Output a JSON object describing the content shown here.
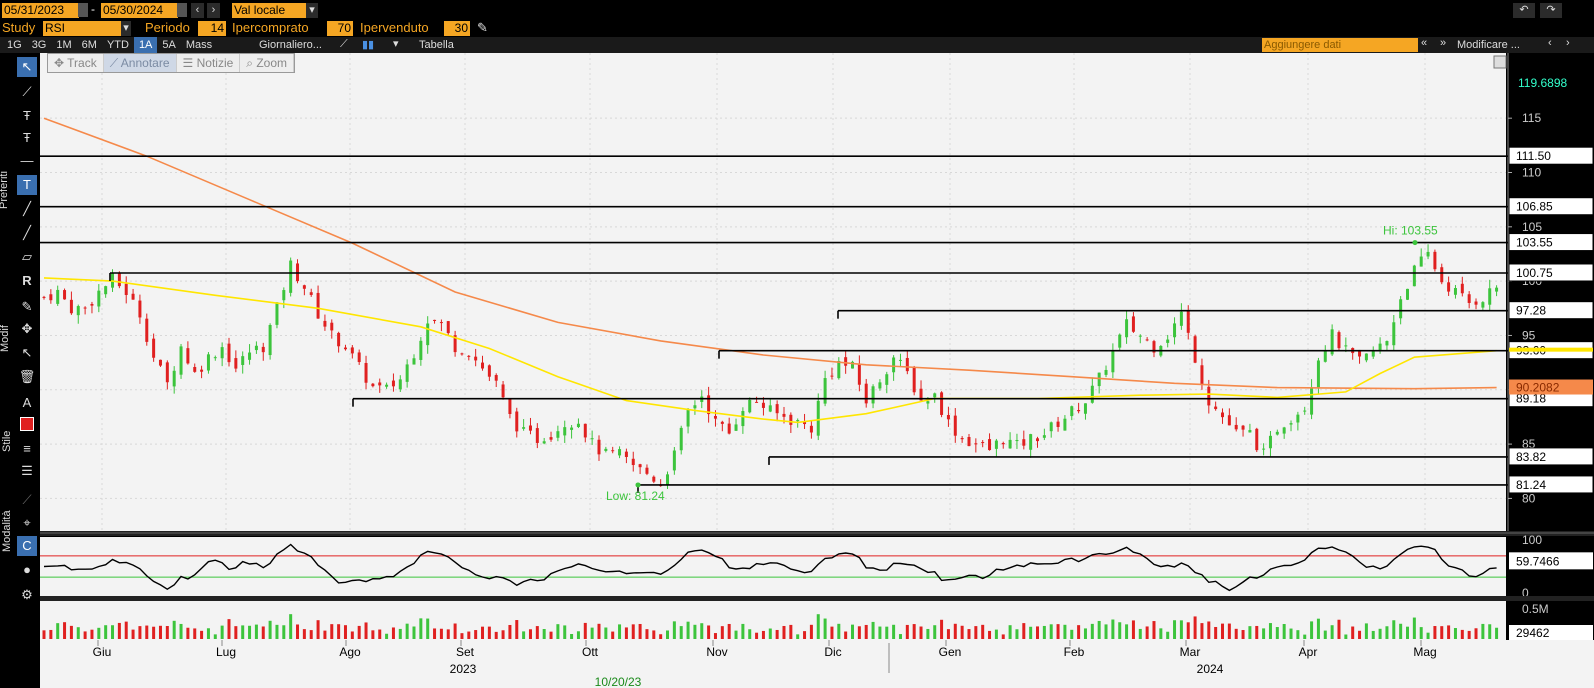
{
  "toolbar": {
    "date_start": "05/31/2023",
    "date_sep": "-",
    "date_end": "05/30/2024",
    "currency": "Val locale",
    "study_label": "Study",
    "study_value": "RSI",
    "period_label": "Periodo",
    "period_value": "14",
    "overbought_label": "Ipercomprato",
    "overbought_value": "70",
    "oversold_label": "Ipervenduto",
    "oversold_value": "30",
    "ranges": [
      "1G",
      "3G",
      "1M",
      "6M",
      "YTD",
      "1A",
      "5A",
      "Mass"
    ],
    "selected_range": "1A",
    "frequency": "Giornaliero...",
    "table_label": "Tabella",
    "add_data_placeholder": "Aggiungere dati",
    "modify_label": "Modificare ..."
  },
  "chart_tools": [
    "Track",
    "Annotare",
    "Notizie",
    "Zoom"
  ],
  "chart_tools_selected": "Annotare",
  "sidebar_labels": [
    "Preferiti",
    "Modif",
    "Stile",
    "Modalità"
  ],
  "colors": {
    "up": "#3cc43c",
    "down": "#e02020",
    "ma_short": "#ffe600",
    "ma_long": "#f5894a",
    "rsi_high": "#e02020",
    "rsi_low": "#3cc43c",
    "accent": "#f5a623"
  },
  "chart_data": [
    {
      "type": "candlestick",
      "ylim": [
        77,
        121
      ],
      "yticks": [
        80,
        85,
        90,
        95,
        100,
        105,
        110,
        115
      ],
      "last_price_label": "119.6898",
      "x_months": [
        "Giu",
        "Lug",
        "Ago",
        "Set",
        "Ott",
        "Nov",
        "Dic",
        "Gen",
        "Feb",
        "Mar",
        "Apr",
        "Mag"
      ],
      "x_years": [
        "2023",
        "2024"
      ],
      "crosshair_date": "10/20/23",
      "hi_annotation": "Hi: 103.55",
      "low_annotation": "Low: 81.24",
      "horizontal_lines": [
        {
          "value": 111.5,
          "label": "111.50"
        },
        {
          "value": 106.85,
          "label": "106.85"
        },
        {
          "value": 103.55,
          "label": "103.55"
        },
        {
          "value": 100.75,
          "label": "100.75"
        },
        {
          "value": 97.28,
          "label": "97.28"
        },
        {
          "value": 93.6,
          "label": "93.60"
        },
        {
          "value": 89.18,
          "label": "89.18"
        },
        {
          "value": 83.82,
          "label": "83.82"
        },
        {
          "value": 81.24,
          "label": "81.24"
        }
      ],
      "ma_short_label": "93.60",
      "ma_long_label": "90.2082",
      "close_points": [
        [
          0,
          98.5
        ],
        [
          4,
          99
        ],
        [
          8,
          97.5
        ],
        [
          12,
          97.5
        ],
        [
          16,
          99
        ],
        [
          20,
          100.2
        ],
        [
          24,
          99
        ],
        [
          28,
          97
        ],
        [
          32,
          93
        ],
        [
          36,
          90.5
        ],
        [
          40,
          94
        ],
        [
          44,
          91.5
        ],
        [
          48,
          93
        ],
        [
          52,
          94
        ],
        [
          56,
          92
        ],
        [
          60,
          93.5
        ],
        [
          64,
          94
        ],
        [
          68,
          97.5
        ],
        [
          72,
          101.5
        ],
        [
          76,
          99.5
        ],
        [
          80,
          97
        ],
        [
          84,
          95
        ],
        [
          88,
          94
        ],
        [
          92,
          92
        ],
        [
          96,
          90.2
        ],
        [
          100,
          90
        ],
        [
          104,
          91
        ],
        [
          108,
          93.5
        ],
        [
          112,
          96.5
        ],
        [
          116,
          96
        ],
        [
          120,
          94
        ],
        [
          124,
          93.5
        ],
        [
          128,
          92
        ],
        [
          132,
          90.5
        ],
        [
          136,
          87.5
        ],
        [
          140,
          86
        ],
        [
          144,
          85.5
        ],
        [
          148,
          86
        ],
        [
          152,
          87
        ],
        [
          156,
          87.2
        ],
        [
          160,
          85
        ],
        [
          164,
          84
        ],
        [
          168,
          84
        ],
        [
          172,
          83
        ],
        [
          176,
          82.3
        ],
        [
          180,
          81.4
        ],
        [
          184,
          84
        ],
        [
          188,
          88
        ],
        [
          192,
          89.5
        ],
        [
          196,
          87
        ],
        [
          200,
          86
        ],
        [
          204,
          88.5
        ],
        [
          208,
          89
        ],
        [
          212,
          88
        ],
        [
          216,
          87.5
        ],
        [
          220,
          87
        ],
        [
          224,
          86.5
        ],
        [
          228,
          91
        ],
        [
          232,
          92.5
        ],
        [
          236,
          92
        ],
        [
          240,
          89
        ],
        [
          244,
          91
        ],
        [
          248,
          93
        ],
        [
          252,
          91.5
        ],
        [
          256,
          89
        ],
        [
          260,
          89.5
        ],
        [
          264,
          87
        ],
        [
          268,
          85.5
        ],
        [
          272,
          85
        ],
        [
          276,
          84.5
        ],
        [
          280,
          85.5
        ],
        [
          284,
          84.8
        ],
        [
          288,
          85.5
        ],
        [
          292,
          86
        ],
        [
          296,
          87
        ],
        [
          300,
          88
        ],
        [
          304,
          89
        ],
        [
          308,
          91
        ],
        [
          312,
          93.5
        ],
        [
          316,
          96
        ],
        [
          320,
          95
        ],
        [
          324,
          94
        ],
        [
          328,
          95
        ],
        [
          332,
          97
        ],
        [
          336,
          93
        ],
        [
          340,
          89
        ],
        [
          344,
          87.5
        ],
        [
          348,
          86
        ],
        [
          352,
          86
        ],
        [
          356,
          84
        ],
        [
          360,
          86.5
        ],
        [
          364,
          87.5
        ],
        [
          368,
          88.5
        ],
        [
          372,
          93
        ],
        [
          376,
          95
        ],
        [
          380,
          93.5
        ],
        [
          384,
          92.5
        ],
        [
          388,
          93.5
        ],
        [
          392,
          94.5
        ],
        [
          396,
          98.5
        ],
        [
          400,
          101
        ],
        [
          404,
          102.5
        ],
        [
          408,
          100
        ],
        [
          412,
          99
        ],
        [
          416,
          98
        ],
        [
          420,
          98.5
        ],
        [
          424,
          99.5
        ]
      ],
      "ma_short": [
        [
          0,
          100.3
        ],
        [
          20,
          100
        ],
        [
          50,
          98.7
        ],
        [
          80,
          97.5
        ],
        [
          110,
          95.8
        ],
        [
          130,
          93.8
        ],
        [
          150,
          91.2
        ],
        [
          170,
          89
        ],
        [
          190,
          88.1
        ],
        [
          210,
          87.3
        ],
        [
          220,
          87
        ],
        [
          240,
          87.8
        ],
        [
          260,
          89.2
        ],
        [
          290,
          89.2
        ],
        [
          320,
          89.5
        ],
        [
          340,
          89.6
        ],
        [
          360,
          89.3
        ],
        [
          380,
          89.8
        ],
        [
          390,
          91.5
        ],
        [
          400,
          93
        ],
        [
          424,
          93.6
        ]
      ],
      "ma_long": [
        [
          0,
          115
        ],
        [
          30,
          111.5
        ],
        [
          60,
          107.5
        ],
        [
          90,
          103.5
        ],
        [
          120,
          99
        ],
        [
          150,
          96.2
        ],
        [
          180,
          94.5
        ],
        [
          210,
          93.2
        ],
        [
          240,
          92.3
        ],
        [
          270,
          91.8
        ],
        [
          300,
          91.2
        ],
        [
          330,
          90.6
        ],
        [
          360,
          90.2
        ],
        [
          400,
          90.1
        ],
        [
          424,
          90.2
        ]
      ]
    },
    {
      "type": "line",
      "name": "RSI",
      "ylim": [
        0,
        100
      ],
      "yticks": [
        0,
        100
      ],
      "last_label": "59.7466",
      "overbought": 70,
      "oversold": 30
    },
    {
      "type": "bar",
      "name": "Volume",
      "ytick_label": "0.5M",
      "last_label": "29462"
    }
  ]
}
